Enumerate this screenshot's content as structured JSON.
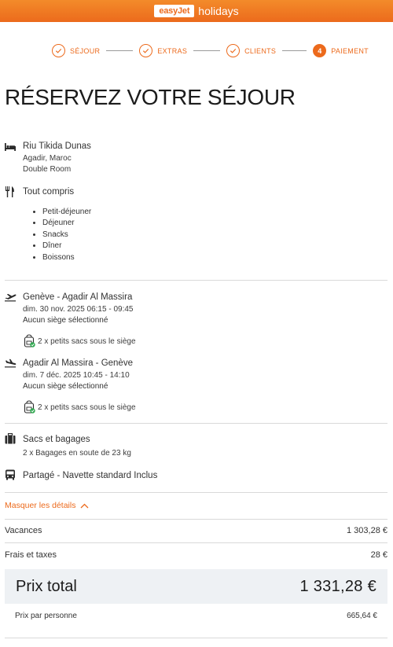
{
  "header": {
    "logo_box": "easyJet",
    "logo_suffix": "holidays"
  },
  "steps": [
    {
      "label": "SÉJOUR",
      "state": "done"
    },
    {
      "label": "EXTRAS",
      "state": "done"
    },
    {
      "label": "CLIENTS",
      "state": "done"
    },
    {
      "label": "PAIEMENT",
      "state": "active",
      "number": "4"
    }
  ],
  "title": "RÉSERVEZ VOTRE SÉJOUR",
  "hotel": {
    "name": "Riu Tikida Dunas",
    "location": "Agadir, Maroc",
    "room": "Double Room",
    "icon": "bed-icon"
  },
  "board": {
    "label": "Tout compris",
    "icon": "cutlery-icon",
    "items": [
      "Petit-déjeuner",
      "Déjeuner",
      "Snacks",
      "Dîner",
      "Boissons"
    ]
  },
  "outbound": {
    "route": "Genève - Agadir Al Massira",
    "datetime": "dim. 30 nov. 2025 06:15 - 09:45",
    "seat": "Aucun siège sélectionné",
    "bags": "2 x petits sacs sous le siège",
    "icon": "takeoff-icon"
  },
  "inbound": {
    "route": "Agadir Al Massira - Genève",
    "datetime": "dim. 7 déc. 2025 10:45 - 14:10",
    "seat": "Aucun siège sélectionné",
    "bags": "2 x petits sacs sous le siège",
    "icon": "landing-icon"
  },
  "luggage": {
    "label": "Sacs et bagages",
    "detail": "2 x Bagages en soute de 23 kg",
    "icon": "luggage-icon"
  },
  "transfer": {
    "label": "Partagé - Navette standard Inclus",
    "icon": "bus-icon"
  },
  "details_toggle": "Masquer les détails",
  "prices": {
    "vacances_label": "Vacances",
    "vacances_value": "1 303,28 €",
    "frais_label": "Frais et taxes",
    "frais_value": "28 €",
    "total_label": "Prix total",
    "total_value": "1 331,28 €",
    "pp_label": "Prix par personne",
    "pp_value": "665,64 €"
  },
  "colors": {
    "accent": "#ec6a1c",
    "total_bg": "#eef1f4"
  }
}
